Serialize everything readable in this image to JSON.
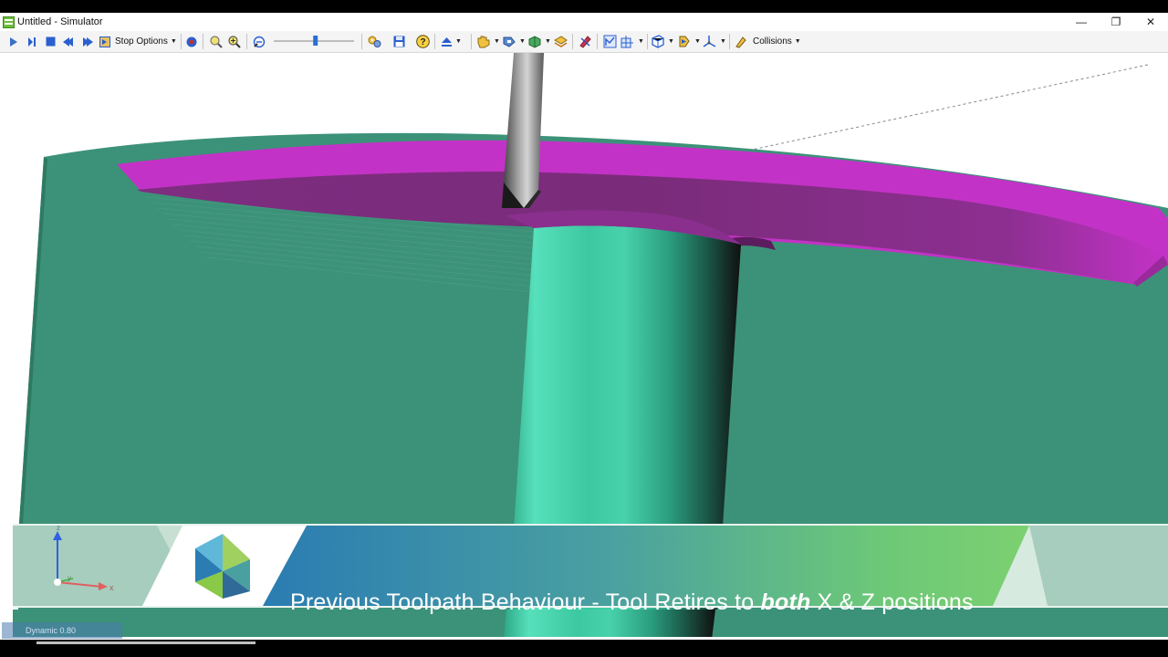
{
  "window": {
    "title": "Untitled - Simulator",
    "controls": {
      "minimize": "—",
      "restore": "❐",
      "close": "✕"
    }
  },
  "toolbar": {
    "stop_options_label": "Stop Options",
    "collisions_label": "Collisions",
    "speed_slider_level": 0.52,
    "buttons": [
      "play",
      "step",
      "stop",
      "rewind",
      "fast-forward",
      "to-end",
      "record",
      "zoom",
      "zoom-area",
      "zoom-fit",
      "settings",
      "save",
      "help",
      "eject",
      "view",
      "cut-tool",
      "stock",
      "layers",
      "palette",
      "measure",
      "section",
      "views",
      "camera",
      "display",
      "collisions"
    ]
  },
  "banner": {
    "title_before": "Previous Toolpath Behaviour - Tool Retires to ",
    "title_emphasis": "both",
    "title_after": " X & Z positions"
  },
  "axes": {
    "x_label": "x",
    "y_label": "y",
    "z_label": "z"
  },
  "status": {
    "text": "Dynamic 0.80"
  },
  "colors": {
    "stock": "#3c9278",
    "part_rim": "#c332c6",
    "part_inner": "#7a2c7a",
    "shaft": "#3cc8a0",
    "banner_blue": "#2f82b0",
    "banner_green": "#6cc878"
  }
}
